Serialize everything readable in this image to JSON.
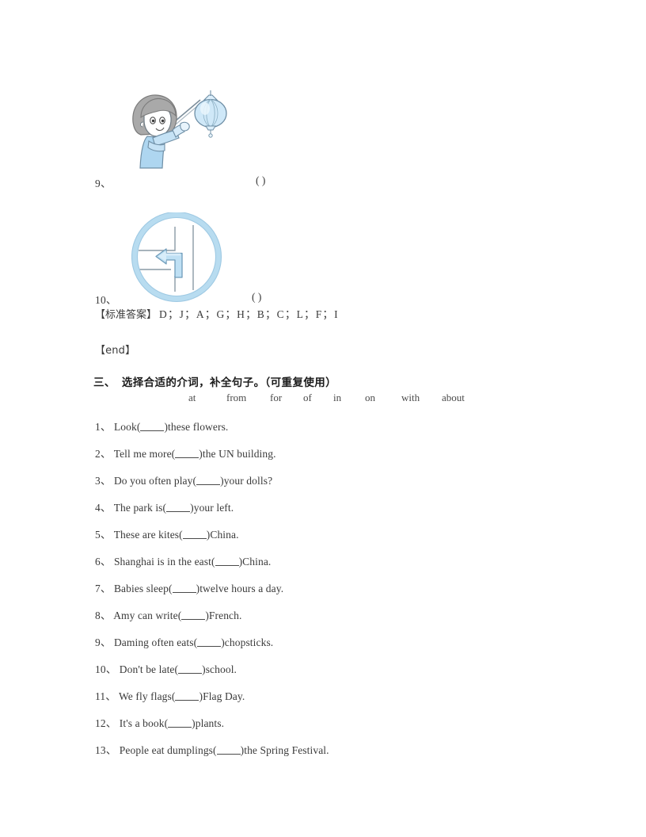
{
  "document": {
    "image_questions": [
      {
        "number": "9、",
        "paren": "(  )",
        "illustration": "boy-holding-lantern"
      },
      {
        "number": "10、",
        "paren": "(  )",
        "illustration": "turn-left-traffic-sign"
      }
    ],
    "answer_key": {
      "label": "【标准答案】",
      "value": "D；J；A；G；H；B；C；L；F；I"
    },
    "end_marker": "【end】",
    "section": {
      "number": "三、",
      "title": "选择合适的介词，补全句子。（可重复使用）"
    },
    "word_bank": [
      "at",
      "from",
      "for",
      "of",
      "in",
      "on",
      "with",
      "about"
    ],
    "questions": [
      {
        "index": "1、",
        "before": "Look(",
        "after": ")these flowers."
      },
      {
        "index": "2、",
        "before": "Tell me more(",
        "after": ")the UN building."
      },
      {
        "index": "3、",
        "before": "Do you often play(",
        "after": ")your dolls?"
      },
      {
        "index": "4、",
        "before": "The park is(",
        "after": ")your left."
      },
      {
        "index": "5、",
        "before": "These are kites(",
        "after": ")China."
      },
      {
        "index": "6、",
        "before": "Shanghai is in the east(",
        "after": ")China."
      },
      {
        "index": "7、",
        "before": "Babies sleep(",
        "after": ")twelve hours a day."
      },
      {
        "index": "8、",
        "before": "Amy can write(",
        "after": ")French."
      },
      {
        "index": "9、",
        "before": "Daming often eats(",
        "after": ")chopsticks."
      },
      {
        "index": "10、",
        "before": "Don't be late(",
        "after": ")school."
      },
      {
        "index": "11、",
        "before": "We fly flags(",
        "after": ")Flag Day."
      },
      {
        "index": "12、",
        "before": "It's a book(",
        "after": ")plants."
      },
      {
        "index": "13、",
        "before": "People eat dumplings(",
        "after": ")the Spring Festival."
      }
    ],
    "colors": {
      "illustration_fill": "#b9dcf2",
      "illustration_light": "#d6ebf9",
      "illustration_stroke": "#6f8fa6",
      "hair": "#a9a9a9",
      "text": "#3a3a3a"
    }
  }
}
